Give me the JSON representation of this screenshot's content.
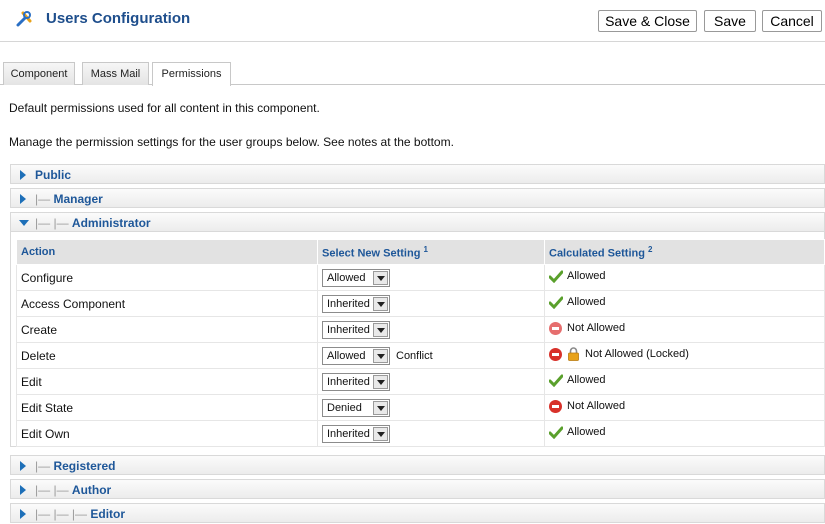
{
  "header": {
    "title": "Users Configuration",
    "save_close_label": "Save & Close",
    "save_label": "Save",
    "cancel_label": "Cancel"
  },
  "tabs": [
    {
      "label": "Component"
    },
    {
      "label": "Mass Mail"
    },
    {
      "label": "Permissions",
      "active": true
    }
  ],
  "description": {
    "line1": "Default permissions used for all content in this component.",
    "line2": "Manage the permission settings for the user groups below. See notes at the bottom."
  },
  "groups": [
    {
      "prefix": "",
      "name": "Public",
      "expanded": false
    },
    {
      "prefix": "|— ",
      "name": "Manager",
      "expanded": false
    },
    {
      "prefix": "|— |— ",
      "name": "Administrator",
      "expanded": true
    },
    {
      "prefix": "|— ",
      "name": "Registered",
      "expanded": false
    },
    {
      "prefix": "|— |— ",
      "name": "Author",
      "expanded": false
    },
    {
      "prefix": "|— |— |— ",
      "name": "Editor",
      "expanded": false
    }
  ],
  "table": {
    "headers": {
      "action": "Action",
      "select": "Select New Setting",
      "select_note": "1",
      "calculated": "Calculated Setting",
      "calculated_note": "2"
    },
    "rows": [
      {
        "action": "Configure",
        "setting": "Allowed",
        "note": "",
        "calculated": "Allowed",
        "status": "allowed"
      },
      {
        "action": "Access Component",
        "setting": "Inherited",
        "note": "",
        "calculated": "Allowed",
        "status": "allowed"
      },
      {
        "action": "Create",
        "setting": "Inherited",
        "note": "",
        "calculated": "Not Allowed",
        "status": "not-allowed-soft"
      },
      {
        "action": "Delete",
        "setting": "Allowed",
        "note": "Conflict",
        "calculated": "Not Allowed (Locked)",
        "status": "locked"
      },
      {
        "action": "Edit",
        "setting": "Inherited",
        "note": "",
        "calculated": "Allowed",
        "status": "allowed"
      },
      {
        "action": "Edit State",
        "setting": "Denied",
        "note": "",
        "calculated": "Not Allowed",
        "status": "not-allowed"
      },
      {
        "action": "Edit Own",
        "setting": "Inherited",
        "note": "",
        "calculated": "Allowed",
        "status": "allowed"
      }
    ]
  },
  "colors": {
    "link_blue": "#1e5799",
    "allowed_green": "#5aa02c",
    "denied_red": "#d8312a"
  },
  "icons": {
    "app": "tools-icon",
    "collapsed": "triangle-right-icon",
    "expanded": "triangle-down-icon",
    "allowed": "check-icon",
    "not_allowed": "no-entry-icon",
    "locked": "padlock-icon"
  }
}
